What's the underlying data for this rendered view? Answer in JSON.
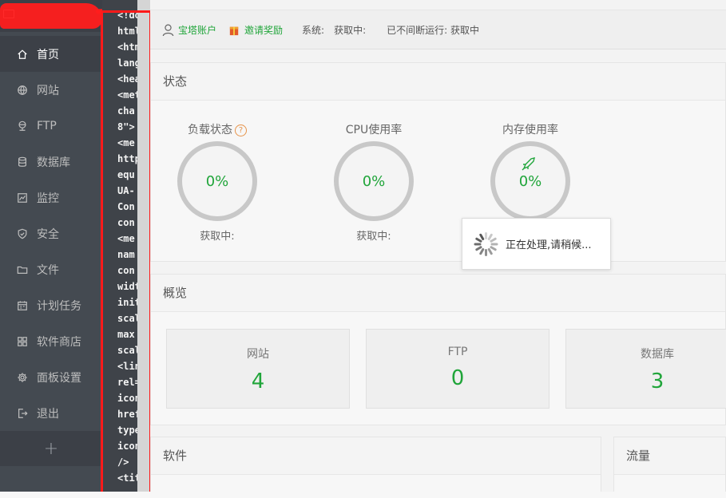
{
  "sidebar": {
    "items": [
      {
        "label": "首页",
        "icon": "home-icon",
        "active": true
      },
      {
        "label": "网站",
        "icon": "globe-icon"
      },
      {
        "label": "FTP",
        "icon": "ftp-icon"
      },
      {
        "label": "数据库",
        "icon": "database-icon"
      },
      {
        "label": "监控",
        "icon": "monitor-icon"
      },
      {
        "label": "安全",
        "icon": "shield-icon"
      },
      {
        "label": "文件",
        "icon": "folder-icon"
      },
      {
        "label": "计划任务",
        "icon": "calendar-icon"
      },
      {
        "label": "软件商店",
        "icon": "grid-icon"
      },
      {
        "label": "面板设置",
        "icon": "gear-icon"
      },
      {
        "label": "退出",
        "icon": "logout-icon"
      }
    ],
    "add_label": "+"
  },
  "source_overlay": {
    "lines": [
      "<!do",
      "html",
      "<htm",
      "lang",
      "<hea",
      "<met",
      "cha",
      "8\">",
      "<me",
      "http",
      "equ",
      "UA-",
      "Con",
      "con",
      "<me",
      "nam",
      "con",
      "widt",
      "initi",
      "scal",
      "max",
      "scal",
      "<lin",
      "rel=",
      "icon",
      "href",
      "type",
      "icon",
      "/>",
      "<titl"
    ]
  },
  "topbar": {
    "account_label": "宝塔账户",
    "invite_label": "邀请奖励",
    "system_label": "系统:",
    "system_value": "获取中:",
    "uptime_label": "已不间断运行: 获取中"
  },
  "status": {
    "title": "状态",
    "gauges": [
      {
        "label": "负载状态",
        "value": "0%",
        "sub": "获取中:",
        "has_help": true
      },
      {
        "label": "CPU使用率",
        "value": "0%",
        "sub": "获取中:"
      },
      {
        "label": "内存使用率",
        "value": "0%",
        "sub": ""
      }
    ]
  },
  "loading": {
    "text": "正在处理,请稍候..."
  },
  "overview": {
    "title": "概览",
    "boxes": [
      {
        "label": "网站",
        "value": "4"
      },
      {
        "label": "FTP",
        "value": "0"
      },
      {
        "label": "数据库",
        "value": "3"
      }
    ]
  },
  "software": {
    "title": "软件"
  },
  "traffic": {
    "title": "流量"
  },
  "colors": {
    "accent": "#20a53a",
    "sidebar_bg": "#444a51",
    "highlight_red": "#ff1a1a"
  }
}
